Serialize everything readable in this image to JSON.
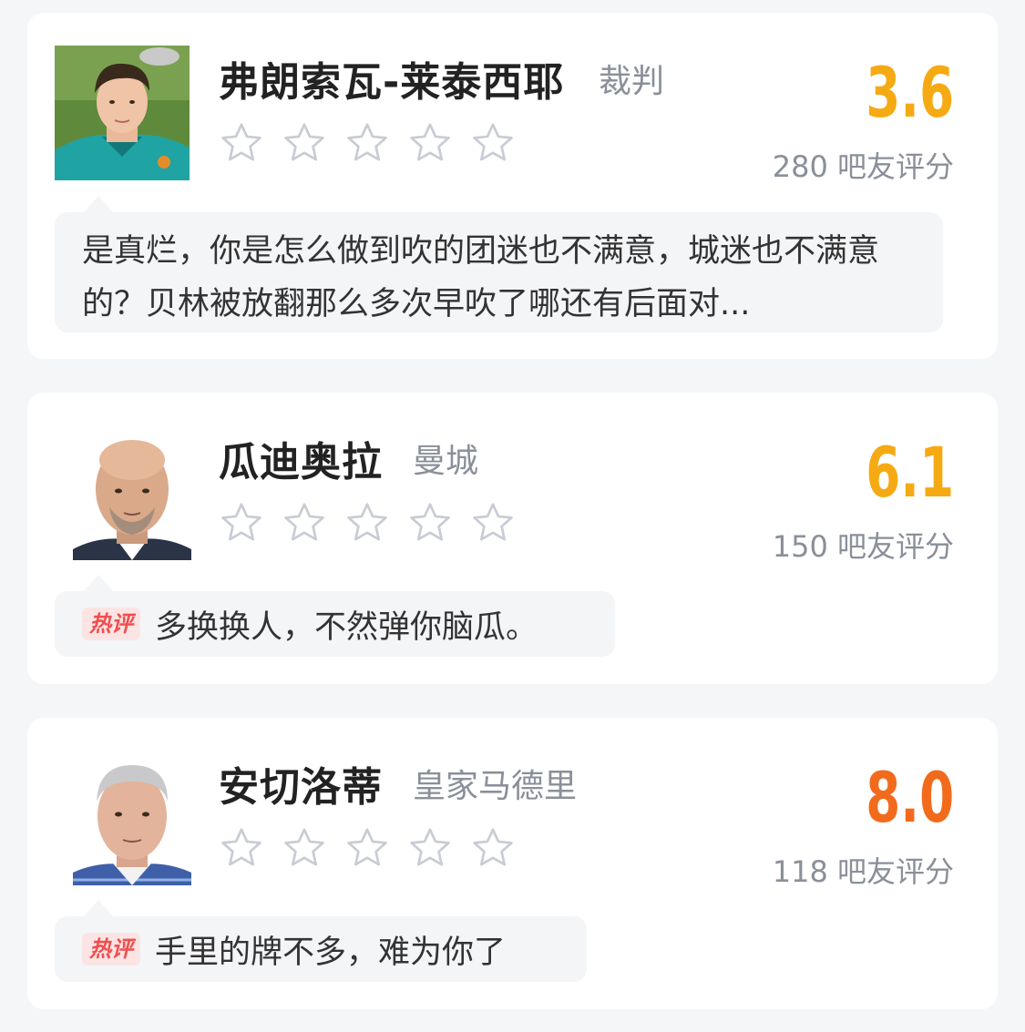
{
  "cards": [
    {
      "name": "弗朗索瓦-莱泰西耶",
      "role": "裁判",
      "score": "3.6",
      "score_color": "#f5aa14",
      "rating_count": "280 吧友评分",
      "stars_total": 5,
      "stars_filled": 0,
      "avatar": "referee-photo",
      "comment_tag": "",
      "comment": "是真烂，你是怎么做到吹的团迷也不满意，城迷也不满意的？贝林被放翻那么多次早吹了哪还有后面对..."
    },
    {
      "name": "瓜迪奥拉",
      "role": "曼城",
      "score": "6.1",
      "score_color": "#f5aa14",
      "rating_count": "150 吧友评分",
      "stars_total": 5,
      "stars_filled": 0,
      "avatar": "coach-photo",
      "comment_tag": "热评",
      "comment": "多换换人，不然弹你脑瓜。"
    },
    {
      "name": "安切洛蒂",
      "role": "皇家马德里",
      "score": "8.0",
      "score_color": "#f26b1d",
      "rating_count": "118 吧友评分",
      "stars_total": 5,
      "stars_filled": 0,
      "avatar": "coach-photo",
      "comment_tag": "热评",
      "comment": "手里的牌不多，难为你了"
    }
  ]
}
